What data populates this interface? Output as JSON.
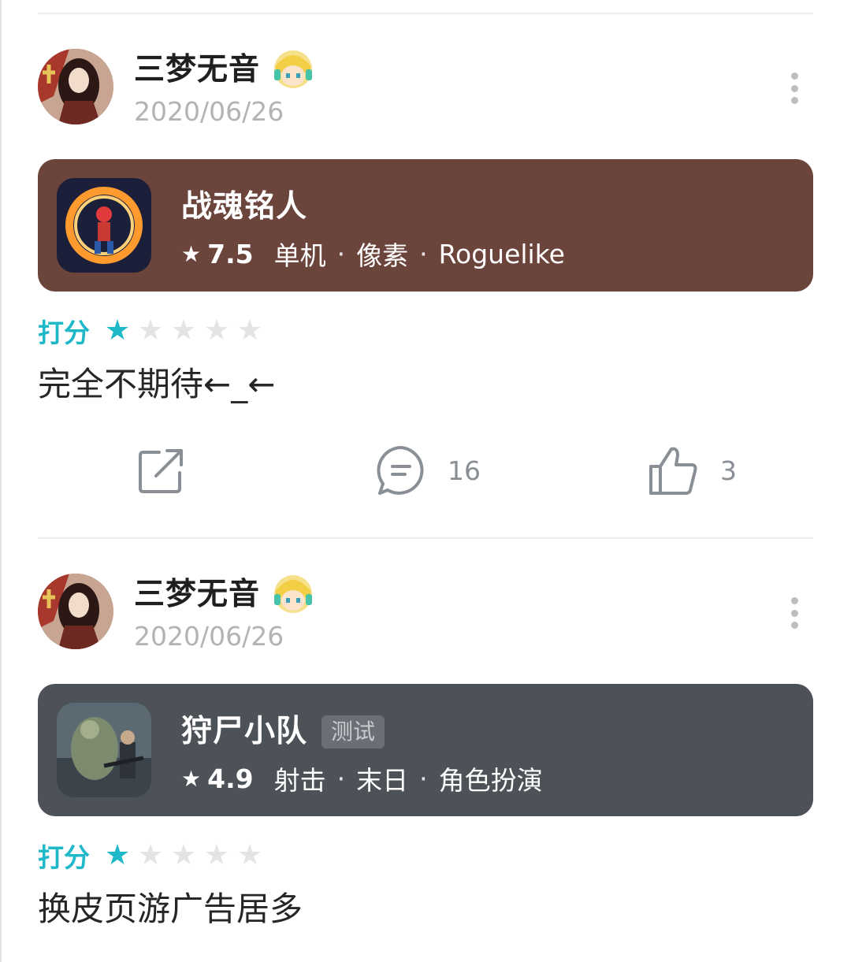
{
  "reviews": [
    {
      "user": {
        "name": "三梦无音",
        "date": "2020/06/26",
        "badge_icon": "pixel-character-badge-icon"
      },
      "game": {
        "name": "战魂铭人",
        "rating": "7.5",
        "tags": [
          "单机",
          "像素",
          "Roguelike"
        ],
        "card_color": "#6b443c",
        "tag_label": ""
      },
      "score_label": "打分",
      "stars": {
        "filled": 1,
        "total": 5,
        "color": "#1fb8c8"
      },
      "text": "完全不期待←_←",
      "actions": {
        "share_count": "",
        "comment_count": "16",
        "like_count": "3"
      }
    },
    {
      "user": {
        "name": "三梦无音",
        "date": "2020/06/26",
        "badge_icon": "pixel-character-badge-icon"
      },
      "game": {
        "name": "狩尸小队",
        "rating": "4.9",
        "tags": [
          "射击",
          "末日",
          "角色扮演"
        ],
        "card_color": "#4d5158",
        "tag_label": "测试"
      },
      "score_label": "打分",
      "stars": {
        "filled": 1,
        "total": 5,
        "color": "#1fb8c8"
      },
      "text": "换皮页游广告居多"
    }
  ],
  "icons": {
    "star": "★",
    "meta_dot": "·"
  }
}
